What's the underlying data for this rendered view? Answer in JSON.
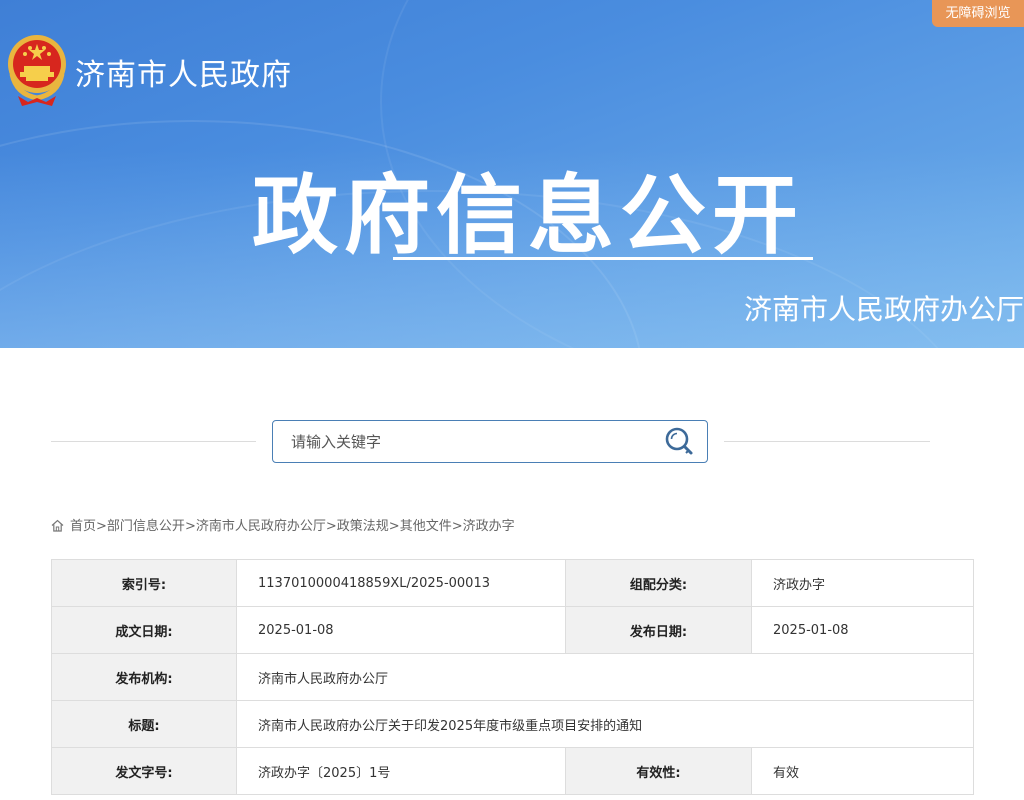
{
  "header": {
    "site_name": "济南市人民政府",
    "accessibility_label": "无障碍浏览",
    "main_title": "政府信息公开",
    "department": "济南市人民政府办公厅",
    "colors": {
      "banner_blue": "#4a8ddf",
      "accent_orange": "#e89657"
    },
    "logo_icon": "national-emblem-icon"
  },
  "search": {
    "placeholder": "请输入关键字",
    "value": "",
    "icon": "search-icon"
  },
  "breadcrumb": {
    "icon": "home-icon",
    "items": [
      "首页",
      "部门信息公开",
      "济南市人民政府办公厅",
      "政策法规",
      "其他文件",
      "济政办字"
    ],
    "separator": ">"
  },
  "info": {
    "index_no_label": "索引号:",
    "index_no": "1137010000418859XL/2025-00013",
    "category_label": "组配分类:",
    "category": "济政办字",
    "written_date_label": "成文日期:",
    "written_date": "2025-01-08",
    "publish_date_label": "发布日期:",
    "publish_date": "2025-01-08",
    "issuer_label": "发布机构:",
    "issuer": "济南市人民政府办公厅",
    "title_label": "标题:",
    "title": "济南市人民政府办公厅关于印发2025年度市级重点项目安排的通知",
    "doc_no_label": "发文字号:",
    "doc_no": "济政办字〔2025〕1号",
    "validity_label": "有效性:",
    "validity": "有效"
  }
}
